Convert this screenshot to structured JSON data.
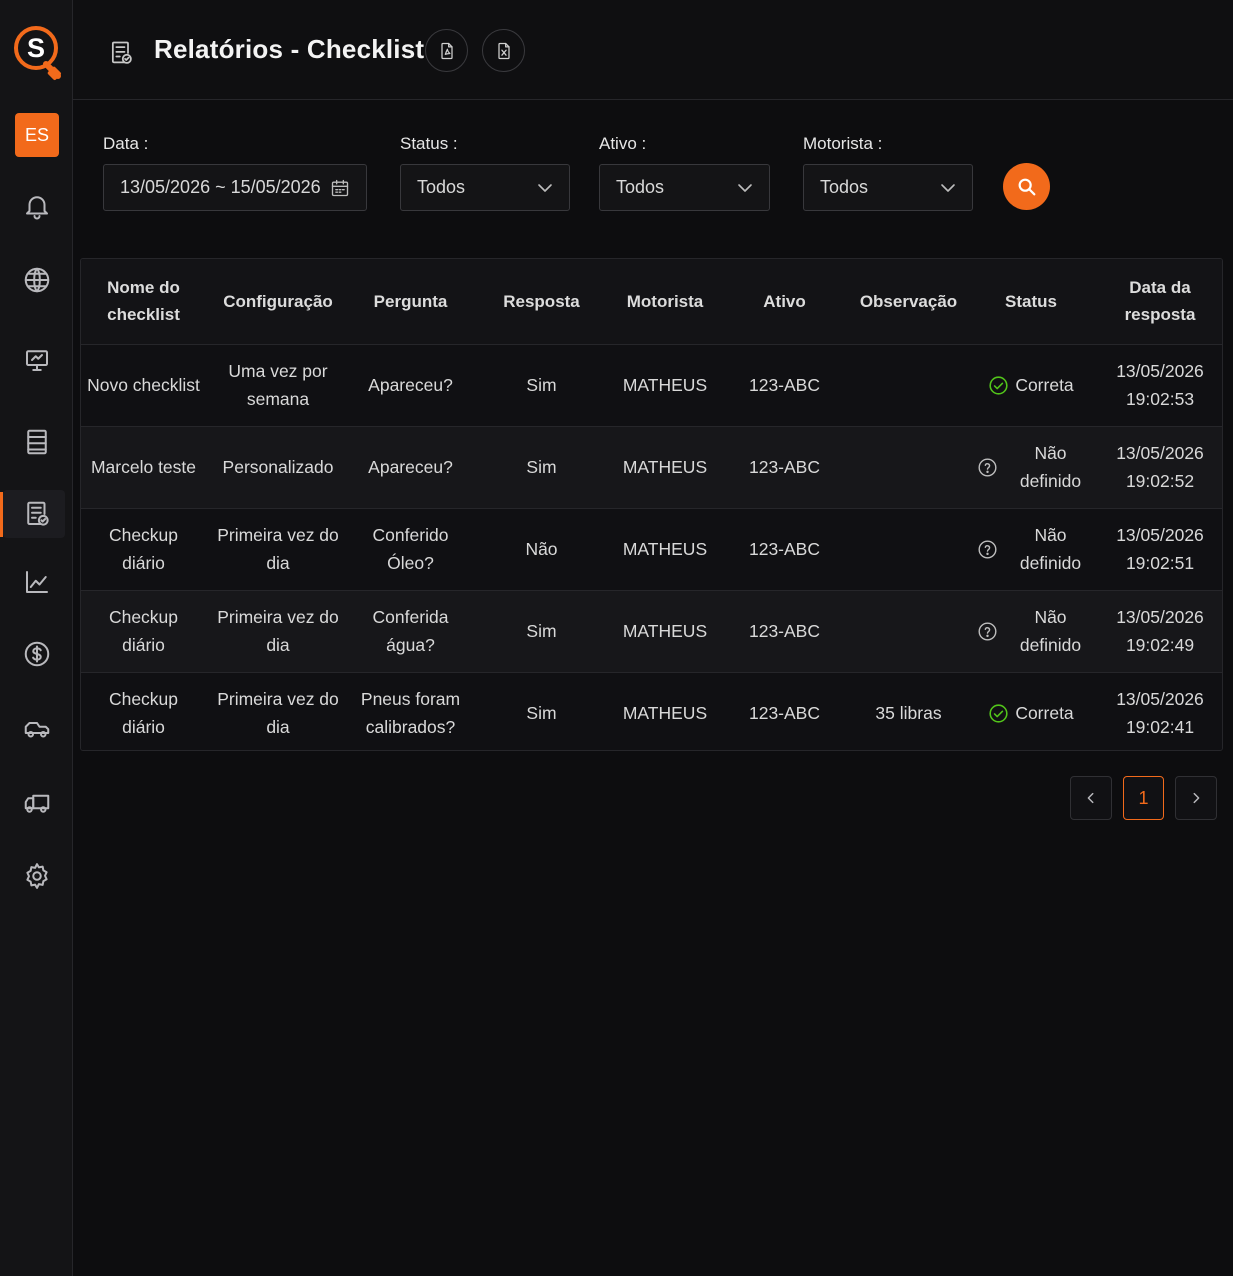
{
  "sidebar": {
    "logo_letter": "S",
    "language": "ES",
    "items": [
      {
        "icon": "bell-icon"
      },
      {
        "icon": "globe-icon"
      },
      {
        "icon": "monitor-icon"
      },
      {
        "icon": "list-icon"
      },
      {
        "icon": "report-checklist-icon",
        "active": true
      },
      {
        "icon": "chart-icon"
      },
      {
        "icon": "dollar-icon"
      },
      {
        "icon": "truck-icon"
      },
      {
        "icon": "truck-alt-icon"
      },
      {
        "icon": "settings-icon"
      }
    ]
  },
  "header": {
    "title": "Relatórios - Checklist",
    "export_pdf_icon": "pdf-file-icon",
    "export_xls_icon": "excel-file-icon"
  },
  "filters": {
    "date_label": "Data :",
    "date_value": "13/05/2026 ~ 15/05/2026",
    "status_label": "Status :",
    "status_value": "Todos",
    "asset_label": "Ativo :",
    "asset_value": "Todos",
    "driver_label": "Motorista :",
    "driver_value": "Todos"
  },
  "table": {
    "headers": {
      "name": "Nome do checklist",
      "config": "Configuração",
      "question": "Pergunta",
      "answer": "Resposta",
      "driver": "Motorista",
      "asset": "Ativo",
      "note": "Observação",
      "status": "Status",
      "date": "Data da resposta"
    },
    "rows": [
      {
        "name": "Novo checklist",
        "config": "Uma vez por semana",
        "question": "Apareceu?",
        "answer": "Sim",
        "driver": "MATHEUS",
        "asset": "123-ABC",
        "note": "",
        "status": "Correta",
        "status_type": "ok",
        "date": "13/05/2026",
        "time": "19:02:53"
      },
      {
        "name": "Marcelo teste",
        "config": "Personalizado",
        "question": "Apareceu?",
        "answer": "Sim",
        "driver": "MATHEUS",
        "asset": "123-ABC",
        "note": "",
        "status": "Não definido",
        "status_type": "undefined",
        "date": "13/05/2026",
        "time": "19:02:52"
      },
      {
        "name": "Checkup diário",
        "config": "Primeira vez do dia",
        "question": "Conferido Óleo?",
        "answer": "Não",
        "driver": "MATHEUS",
        "asset": "123-ABC",
        "note": "",
        "status": "Não definido",
        "status_type": "undefined",
        "date": "13/05/2026",
        "time": "19:02:51"
      },
      {
        "name": "Checkup diário",
        "config": "Primeira vez do dia",
        "question": "Conferida água?",
        "answer": "Sim",
        "driver": "MATHEUS",
        "asset": "123-ABC",
        "note": "",
        "status": "Não definido",
        "status_type": "undefined",
        "date": "13/05/2026",
        "time": "19:02:49"
      },
      {
        "name": "Checkup diário",
        "config": "Primeira vez do dia",
        "question": "Pneus foram calibrados?",
        "answer": "Sim",
        "driver": "MATHEUS",
        "asset": "123-ABC",
        "note": "35 libras",
        "status": "Correta",
        "status_type": "ok",
        "date": "13/05/2026",
        "time": "19:02:41"
      }
    ]
  },
  "pagination": {
    "current_page": "1"
  },
  "colors": {
    "accent": "#f26a1b",
    "ok": "#52c41a",
    "background": "#0d0d0f"
  }
}
